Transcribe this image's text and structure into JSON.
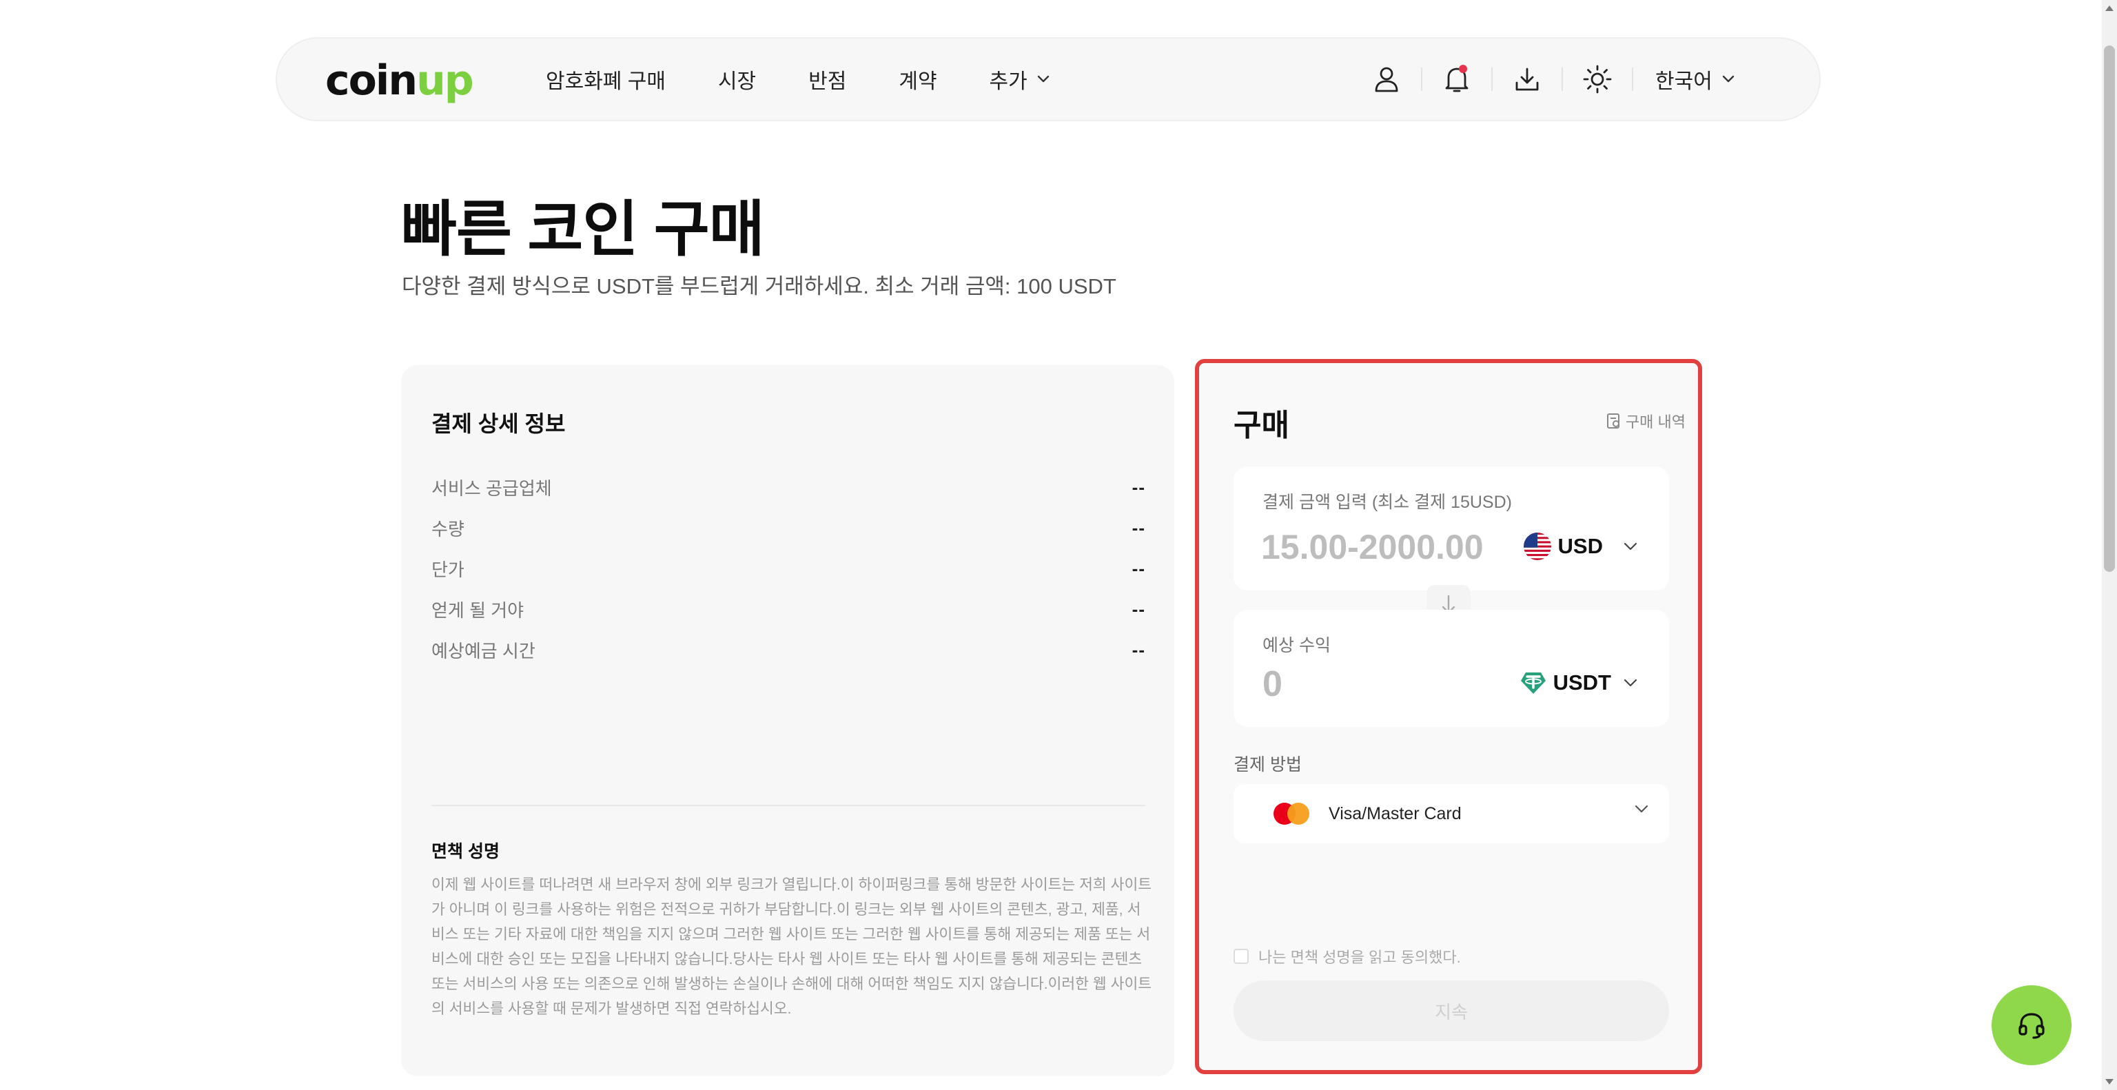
{
  "brand": {
    "logo_part1": "coin",
    "logo_part2": "up",
    "accent_color": "#7ccf3f"
  },
  "nav": {
    "links": [
      {
        "label": "암호화폐 구매"
      },
      {
        "label": "시장"
      },
      {
        "label": "반점"
      },
      {
        "label": "계약"
      },
      {
        "label": "추가"
      }
    ],
    "icons": [
      "user-icon",
      "bell-icon",
      "download-icon",
      "sun-icon"
    ],
    "language": "한국어"
  },
  "page": {
    "title": "빠른 코인 구매",
    "subtitle": "다양한 결제 방식으로 USDT를 부드럽게 거래하세요. 최소 거래 금액: 100 USDT"
  },
  "details": {
    "title": "결제 상세 정보",
    "rows": [
      {
        "label": "서비스 공급업체",
        "value": "--"
      },
      {
        "label": "수량",
        "value": "--"
      },
      {
        "label": "단가",
        "value": "--"
      },
      {
        "label": "얻게 될 거야",
        "value": "--"
      },
      {
        "label": "예상예금 시간",
        "value": "--"
      }
    ],
    "disclaimer_title": "면책 성명",
    "disclaimer_text": "이제 웹 사이트를 떠나려면 새 브라우저 창에 외부 링크가 열립니다.이 하이퍼링크를 통해 방문한 사이트는 저희 사이트가 아니며 이 링크를 사용하는 위험은 전적으로 귀하가 부담합니다.이 링크는 외부 웹 사이트의 콘텐츠, 광고, 제품, 서비스 또는 기타 자료에 대한 책임을 지지 않으며 그러한 웹 사이트 또는 그러한 웹 사이트를 통해 제공되는 제품 또는 서비스에 대한 승인 또는 모집을 나타내지 않습니다.당사는 타사 웹 사이트 또는 타사 웹 사이트를 통해 제공되는 콘텐츠 또는 서비스의 사용 또는 의존으로 인해 발생하는 손실이나 손해에 대해 어떠한 책임도 지지 않습니다.이러한 웹 사이트의 서비스를 사용할 때 문제가 발생하면 직접 연락하십시오."
  },
  "buy": {
    "title": "구매",
    "history_label": "구매 내역",
    "amount_label": "결제 금액 입력 (최소 결제 15USD)",
    "amount_placeholder": "15.00-2000.00",
    "pay_currency": "USD",
    "receive_label": "예상 수익",
    "receive_value": "0",
    "receive_currency": "USDT",
    "method_label": "결제 방법",
    "method_value": "Visa/Master Card",
    "agree_text": "나는 면책 성명을 읽고 동의했다.",
    "continue_label": "지속",
    "highlight_color": "#e2403f"
  }
}
